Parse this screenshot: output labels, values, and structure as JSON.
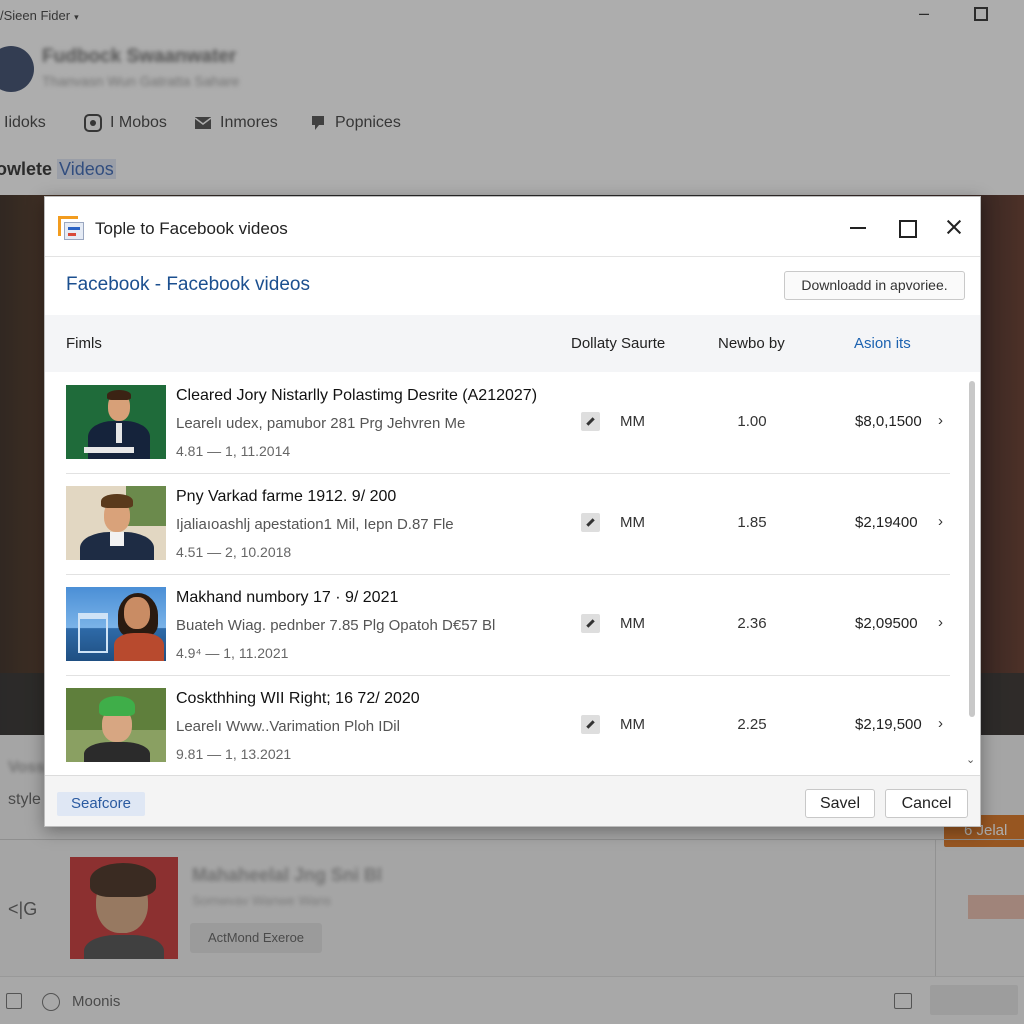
{
  "background_app": {
    "window_title": "/Sieen Fider",
    "profile_name": "Fudbock Swaanwater",
    "profile_sub": "Thanvasn Wun Gatratta Sahare",
    "menu": [
      {
        "label": "Iidoks",
        "icon": "list-icon"
      },
      {
        "label": "I Mobos",
        "icon": "record-icon"
      },
      {
        "label": "Inmores",
        "icon": "mail-icon"
      },
      {
        "label": "Popnices",
        "icon": "pin-icon"
      }
    ],
    "section_title_bold": "owlete ",
    "section_title_highlight": "Videos",
    "lower_text_blur": "Vosss",
    "lower_text": "style",
    "card_title": "Mahaheelal Jng Sni Bl",
    "card_sub": "Somwvav Wanwe Wans",
    "card_chip": "ActMond Exeroe",
    "orange_button": "6 Jelal",
    "status_label": "Moonis"
  },
  "dialog": {
    "title": "Tople to Facebook videos",
    "heading": "Facebook - Facebook videos",
    "download_button": "Downloadd in apvoriee.",
    "columns": [
      "Fimls",
      "Dollaty Saurte",
      "Newbo by",
      "Asion its"
    ],
    "rows": [
      {
        "title": "Cleared Jory Nistarlly Polastimg Desrite (A212027)",
        "desc": "Learelı udex, pamubor 281 Prg Jehvren Me",
        "date": "4.81 — 1, 11.2014",
        "mm": "MM",
        "num": "1.00",
        "price": "$8,0,1500",
        "arrow": "›"
      },
      {
        "title": "Pny Varkad farme 1912. 9/ 200",
        "desc": "Ijaliaıoashlj apestation1 Mil, Iepn D.87 Fle",
        "date": "4.51 — 2, 10.2018",
        "mm": "MM",
        "num": "1.85",
        "price": "$2,19400",
        "arrow": "›"
      },
      {
        "title": "Makhand numbory 17 · 9/ 2021",
        "desc": "Buateh Wiag. pednber 7.85 Plg Opatoh D€57 Bl",
        "date": "4.9⁴ — 1, 11.2021",
        "mm": "MM",
        "num": "2.36",
        "price": "$2,09500",
        "arrow": "›"
      },
      {
        "title": "Coskthhing WII Right; 16 72/ 2020",
        "desc": "Learelı Www..Varimation Ploh IDil",
        "date": "9.81 — 1, 13.2021",
        "mm": "MM",
        "num": "2.25",
        "price": "$2,19,500",
        "arrow": "›"
      }
    ],
    "footer_tag": "Seafcore",
    "save_button": "Savel",
    "cancel_button": "Cancel"
  }
}
